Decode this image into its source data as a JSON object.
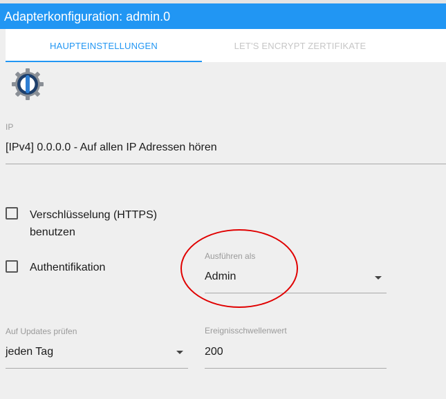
{
  "window": {
    "title": "Adapterkonfiguration: admin.0"
  },
  "tabs": [
    {
      "label": "HAUPTEINSTELLUNGEN",
      "active": true
    },
    {
      "label": "LET'S ENCRYPT ZERTIFIKATE",
      "active": false
    }
  ],
  "logo": {
    "icon": "iobroker-logo-icon"
  },
  "ip": {
    "label": "IP",
    "value": "[IPv4] 0.0.0.0 - Auf allen IP Adressen hören"
  },
  "https": {
    "label_line1": "Verschlüsselung (HTTPS)",
    "label_line2": "benutzen",
    "checked": false
  },
  "auth": {
    "label": "Authentifikation",
    "checked": false
  },
  "run_as": {
    "label": "Ausführen als",
    "value": "Admin"
  },
  "updates": {
    "label": "Auf Updates prüfen",
    "value": "jeden Tag"
  },
  "threshold": {
    "label": "Ereignisschwellenwert",
    "value": "200"
  },
  "colors": {
    "accent": "#2196f3",
    "annotation": "#e00000",
    "background": "#efefef"
  }
}
